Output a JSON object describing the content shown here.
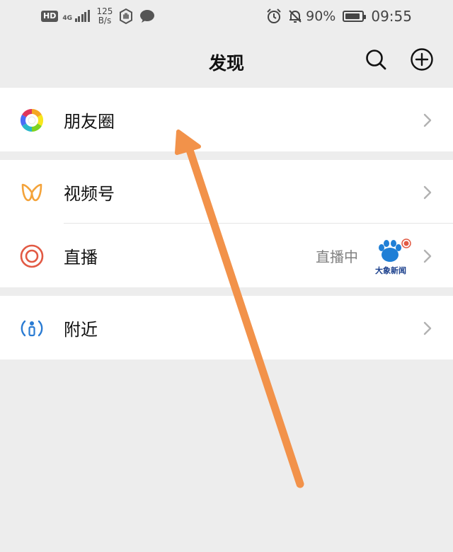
{
  "status_bar": {
    "hd": "HD",
    "network": "4G",
    "speed_value": "125",
    "speed_unit": "B/s",
    "battery": "90%",
    "time": "09:55"
  },
  "header": {
    "title": "发现"
  },
  "sections": [
    {
      "items": [
        {
          "label": "朋友圈",
          "icon": "moments-icon"
        }
      ]
    },
    {
      "items": [
        {
          "label": "视频号",
          "icon": "channels-icon"
        },
        {
          "label": "直播",
          "icon": "live-icon",
          "status": "直播中",
          "avatar_text": "大象新闻"
        }
      ]
    },
    {
      "items": [
        {
          "label": "附近",
          "icon": "nearby-icon"
        }
      ]
    }
  ],
  "colors": {
    "background": "#ededed",
    "annotation_arrow": "#f2924a",
    "live_red": "#e25a44",
    "channels_orange": "#f4a33a",
    "nearby_blue": "#2a7bd3"
  }
}
